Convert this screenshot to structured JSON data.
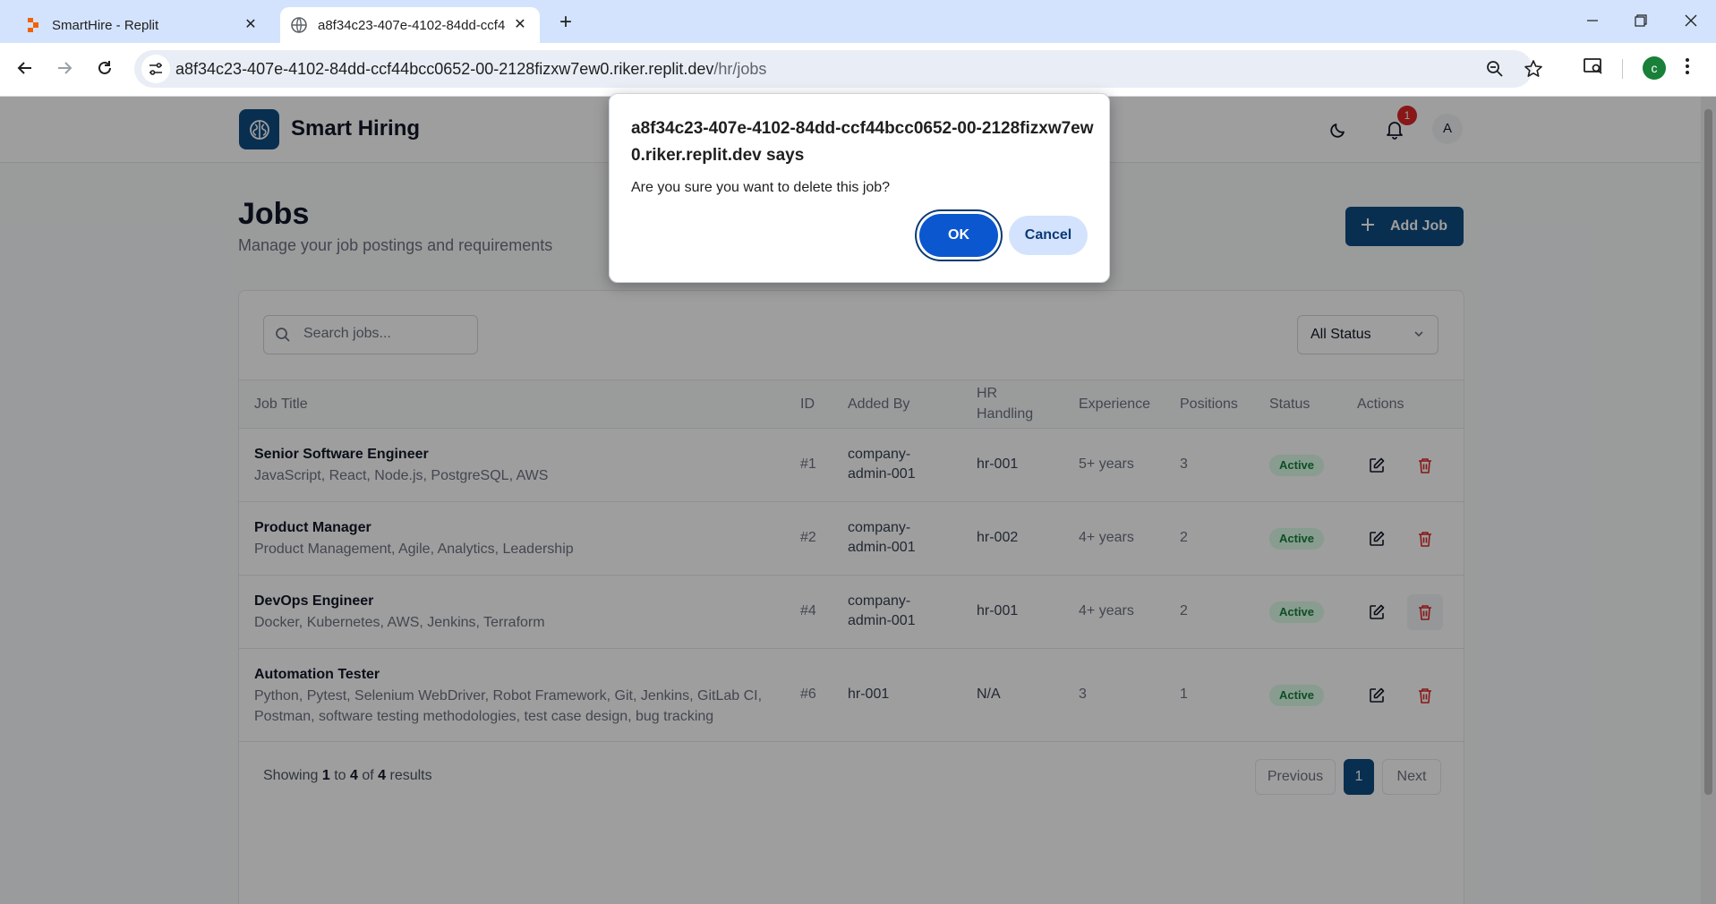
{
  "browser": {
    "tabs": [
      {
        "title": "SmartHire - Replit"
      },
      {
        "title": "a8f34c23-407e-4102-84dd-ccf4"
      }
    ],
    "url_host": "a8f34c23-407e-4102-84dd-ccf44bcc0652-00-2128fizxw7ew0.riker.replit.dev",
    "url_path": "/hr/jobs",
    "profile_initial": "c"
  },
  "app": {
    "brand": "Smart Hiring",
    "notification_count": "1",
    "avatar_initial": "A",
    "page_title": "Jobs",
    "page_subtitle": "Manage your job postings and requirements",
    "add_job_label": "Add Job",
    "search_placeholder": "Search jobs...",
    "status_filter": "All Status",
    "columns": {
      "title": "Job Title",
      "id": "ID",
      "added_by": "Added By",
      "hr_line1": "HR",
      "hr_line2": "Handling",
      "experience": "Experience",
      "positions": "Positions",
      "status": "Status",
      "actions": "Actions"
    },
    "jobs": [
      {
        "title": "Senior Software Engineer",
        "skills": "JavaScript, React, Node.js, PostgreSQL, AWS",
        "id": "#1",
        "added_by_1": "company-",
        "added_by_2": "admin-001",
        "hr": "hr-001",
        "experience": "5+ years",
        "positions": "3",
        "status": "Active"
      },
      {
        "title": "Product Manager",
        "skills": "Product Management, Agile, Analytics, Leadership",
        "id": "#2",
        "added_by_1": "company-",
        "added_by_2": "admin-001",
        "hr": "hr-002",
        "experience": "4+ years",
        "positions": "2",
        "status": "Active"
      },
      {
        "title": "DevOps Engineer",
        "skills": "Docker, Kubernetes, AWS, Jenkins, Terraform",
        "id": "#4",
        "added_by_1": "company-",
        "added_by_2": "admin-001",
        "hr": "hr-001",
        "experience": "4+ years",
        "positions": "2",
        "status": "Active"
      },
      {
        "title": "Automation Tester",
        "skills_1": "Python, Pytest, Selenium WebDriver, Robot Framework, Git, Jenkins, GitLab CI,",
        "skills_2": "Postman, software testing methodologies, test case design, bug tracking",
        "id": "#6",
        "added_by": "hr-001",
        "hr": "N/A",
        "experience": "3",
        "positions": "1",
        "status": "Active"
      }
    ],
    "footer": {
      "prefix": "Showing",
      "from": "1",
      "to_word": "to",
      "to": "4",
      "of_word": "of",
      "total": "4",
      "suffix": "results"
    },
    "pagination": {
      "previous": "Previous",
      "current": "1",
      "next": "Next"
    }
  },
  "dialog": {
    "title": "a8f34c23-407e-4102-84dd-ccf44bcc0652-00-2128fizxw7ew0.riker.replit.dev says",
    "message": "Are you sure you want to delete this job?",
    "ok_label": "OK",
    "cancel_label": "Cancel"
  },
  "colors": {
    "brand": "#0f4c81",
    "active_badge": "#dcfce7",
    "delete_icon": "#dc2626",
    "dialog_ok": "#0b57d0"
  }
}
